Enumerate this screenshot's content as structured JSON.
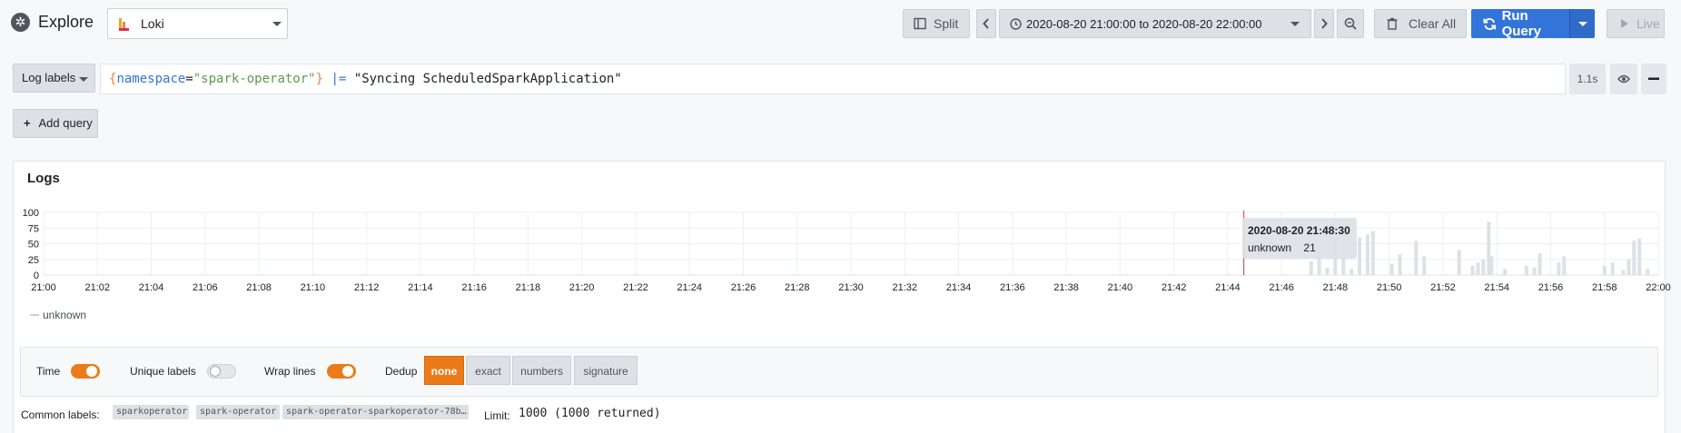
{
  "header": {
    "title": "Explore",
    "datasource": "Loki",
    "split_label": "Split",
    "time_range": "2020-08-20 21:00:00 to 2020-08-20 22:00:00",
    "clear_label": "Clear All",
    "run_label": "Run Query",
    "live_label": "Live"
  },
  "query": {
    "labels_button": "Log labels",
    "brace_open": "{",
    "key": "namespace",
    "eq": "=",
    "value": "\"spark-operator\"",
    "brace_close": "}",
    "pipe": "|=",
    "filter": "\"Syncing ScheduledSparkApplication\"",
    "duration": "1.1s",
    "add_query_label": "Add query"
  },
  "logs": {
    "title": "Logs",
    "legend_label": "unknown",
    "tooltip": {
      "time": "2020-08-20 21:48:30",
      "series": "unknown",
      "value": "21"
    }
  },
  "options": {
    "time_label": "Time",
    "time_on": true,
    "unique_label": "Unique labels",
    "unique_on": false,
    "wrap_label": "Wrap lines",
    "wrap_on": true,
    "dedup_label": "Dedup",
    "dedup_options": [
      "none",
      "exact",
      "numbers",
      "signature"
    ],
    "dedup_selected": "none"
  },
  "footer": {
    "common_labels_label": "Common labels:",
    "labels": [
      "sparkoperator",
      "spark-operator",
      "spark-operator-sparkoperator-78b…"
    ],
    "limit_label": "Limit:",
    "limit_value": "1000 (1000 returned)"
  },
  "colors": {
    "accent": "#eb7b18",
    "primary": "#3274d9",
    "bar": "#dde1e6",
    "cursor": "#e02f44"
  },
  "chart_data": {
    "type": "bar",
    "title": "",
    "xlabel": "",
    "ylabel": "",
    "ylim": [
      0,
      100
    ],
    "y_ticks": [
      "0",
      "25",
      "50",
      "75",
      "100"
    ],
    "x_ticks": [
      "21:00",
      "21:02",
      "21:04",
      "21:06",
      "21:08",
      "21:10",
      "21:12",
      "21:14",
      "21:16",
      "21:18",
      "21:20",
      "21:22",
      "21:24",
      "21:26",
      "21:28",
      "21:30",
      "21:32",
      "21:34",
      "21:36",
      "21:38",
      "21:40",
      "21:42",
      "21:44",
      "21:46",
      "21:48",
      "21:50",
      "21:52",
      "21:54",
      "21:56",
      "21:58",
      "22:00"
    ],
    "x_range_minutes": [
      0,
      60
    ],
    "cursor_minute": 44.6,
    "series": [
      {
        "name": "unknown",
        "x_minutes": [
          47.1,
          47.4,
          47.7,
          48.0,
          48.3,
          48.6,
          48.9,
          49.2,
          49.4,
          50.1,
          50.4,
          51.0,
          51.3,
          52.6,
          53.1,
          53.3,
          53.5,
          53.7,
          53.8,
          54.3,
          55.1,
          55.4,
          55.6,
          56.3,
          56.5,
          58.0,
          58.3,
          58.7,
          58.9,
          59.1,
          59.3,
          59.6
        ],
        "values": [
          22,
          35,
          12,
          52,
          30,
          10,
          60,
          65,
          70,
          18,
          33,
          55,
          30,
          40,
          15,
          20,
          25,
          85,
          30,
          10,
          15,
          12,
          35,
          20,
          30,
          15,
          20,
          8,
          25,
          55,
          58,
          10
        ]
      }
    ]
  }
}
